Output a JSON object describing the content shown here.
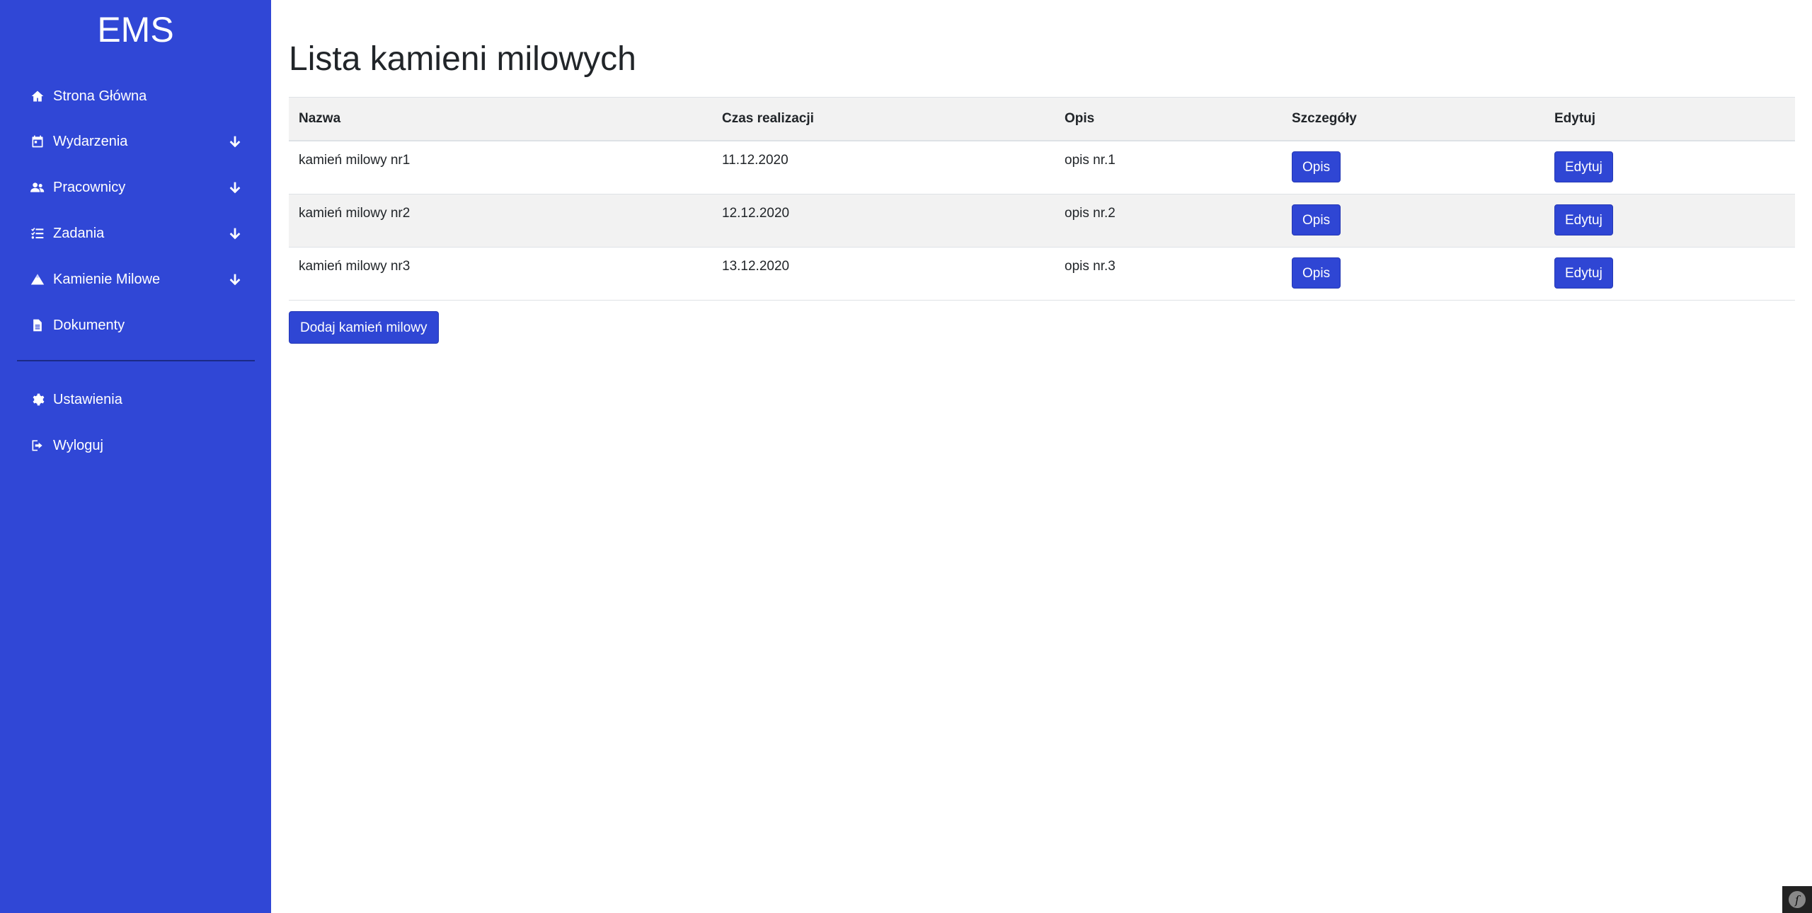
{
  "sidebar": {
    "brand": "EMS",
    "items": [
      {
        "label": "Strona Główna",
        "icon": "home-icon"
      },
      {
        "label": "Wydarzenia",
        "icon": "calendar-icon",
        "expandable": true
      },
      {
        "label": "Pracownicy",
        "icon": "users-icon",
        "expandable": true
      },
      {
        "label": "Zadania",
        "icon": "tasks-icon",
        "expandable": true
      },
      {
        "label": "Kamienie Milowe",
        "icon": "mountain-icon",
        "expandable": true
      },
      {
        "label": "Dokumenty",
        "icon": "document-icon"
      }
    ],
    "bottom_items": [
      {
        "label": "Ustawienia",
        "icon": "gear-icon"
      },
      {
        "label": "Wyloguj",
        "icon": "logout-icon"
      }
    ],
    "background": "#3047d6"
  },
  "main": {
    "title": "Lista kamieni milowych",
    "table": {
      "headers": [
        "Nazwa",
        "Czas realizacji",
        "Opis",
        "Szczegóły",
        "Edytuj"
      ],
      "rows": [
        {
          "name": "kamień milowy nr1",
          "date": "11.12.2020",
          "description": "opis nr.1",
          "details_button": "Opis",
          "edit_button": "Edytuj"
        },
        {
          "name": "kamień milowy nr2",
          "date": "12.12.2020",
          "description": "opis nr.2",
          "details_button": "Opis",
          "edit_button": "Edytuj"
        },
        {
          "name": "kamień milowy nr3",
          "date": "13.12.2020",
          "description": "opis nr.3",
          "details_button": "Opis",
          "edit_button": "Edytuj"
        }
      ]
    },
    "add_button": "Dodaj kamień milowy",
    "accent": "#2f46d4"
  }
}
